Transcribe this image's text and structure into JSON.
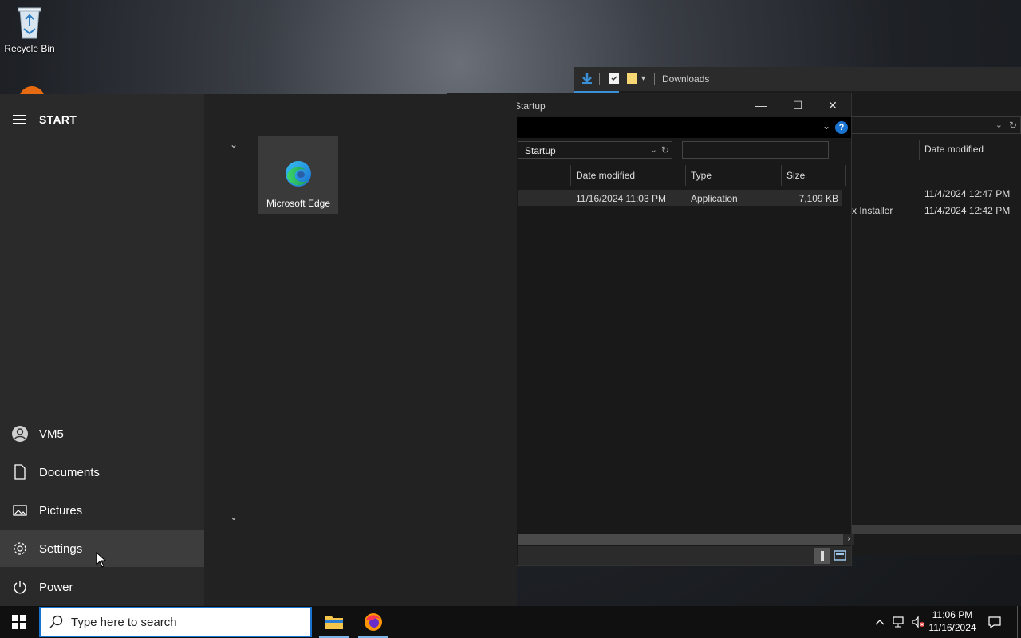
{
  "desktop": {
    "recycle_bin_label": "Recycle Bin"
  },
  "downloads_window": {
    "title": "Downloads",
    "column_date_modified": "Date modified",
    "rows": [
      {
        "name": "",
        "date": "11/4/2024 12:47 PM"
      },
      {
        "name": "x Installer",
        "date": "11/4/2024 12:42 PM"
      }
    ]
  },
  "startup_window": {
    "title": "Startup",
    "address": "Startup",
    "help_label": "?",
    "columns": {
      "date_modified": "Date modified",
      "type": "Type",
      "size": "Size"
    },
    "files": [
      {
        "date": "11/16/2024 11:03 PM",
        "type": "Application",
        "size": "7,109 KB"
      }
    ]
  },
  "start_menu": {
    "title": "START",
    "tiles": [
      {
        "label": "Microsoft Edge",
        "icon": "edge-icon"
      }
    ],
    "nav": [
      {
        "label": "VM5",
        "icon": "user-icon"
      },
      {
        "label": "Documents",
        "icon": "document-icon"
      },
      {
        "label": "Pictures",
        "icon": "pictures-icon"
      },
      {
        "label": "Settings",
        "icon": "gear-icon"
      },
      {
        "label": "Power",
        "icon": "power-icon"
      }
    ],
    "active_item": "Settings"
  },
  "taskbar": {
    "search_placeholder": "Type here to search",
    "apps": [
      {
        "name": "File Explorer",
        "icon": "folder-icon"
      },
      {
        "name": "Firefox",
        "icon": "firefox-icon"
      }
    ],
    "clock_time": "11:06 PM",
    "clock_date": "11/16/2024"
  },
  "colors": {
    "accent": "#1a73d0",
    "start_bg": "#222222",
    "start_left_bg": "#2a2a2a",
    "taskbar_bg": "#101010"
  }
}
